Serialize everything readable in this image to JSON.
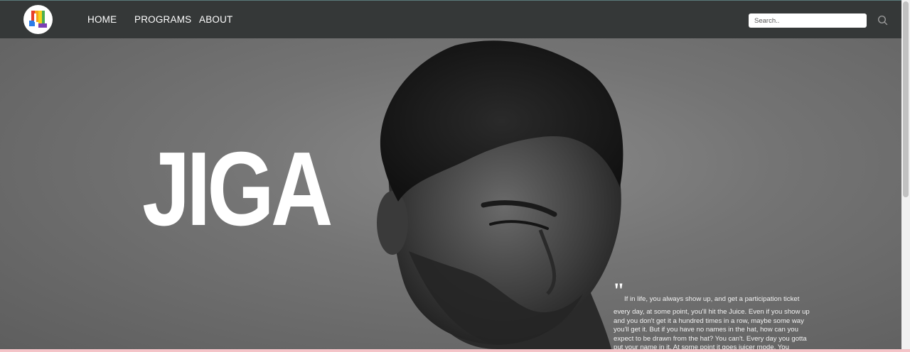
{
  "nav": {
    "items": [
      {
        "label": "HOME"
      },
      {
        "label": "PROGRAMS"
      },
      {
        "label": "ABOUT"
      }
    ],
    "search_placeholder": "Search.."
  },
  "hero": {
    "title": "JIGA",
    "quote_first_line": "If in life, you always show up, and get a participation ticket",
    "quote_body": "every day, at some point, you'll hit the Juice. Even if you show up and you don't get it a hundred times in a row, maybe some way you'll get it. But if you have no names in the hat, how can you expect to be drawn from the hat? You can't. Every day you gotta put your name in it. At some point it goes juicer mode. You"
  },
  "colors": {
    "navbar": "#353838",
    "hero_text": "#ffffff",
    "bottom_strip": "#f4c4c8"
  },
  "icons": [
    "logo-icon",
    "search-icon",
    "quote-icon"
  ]
}
